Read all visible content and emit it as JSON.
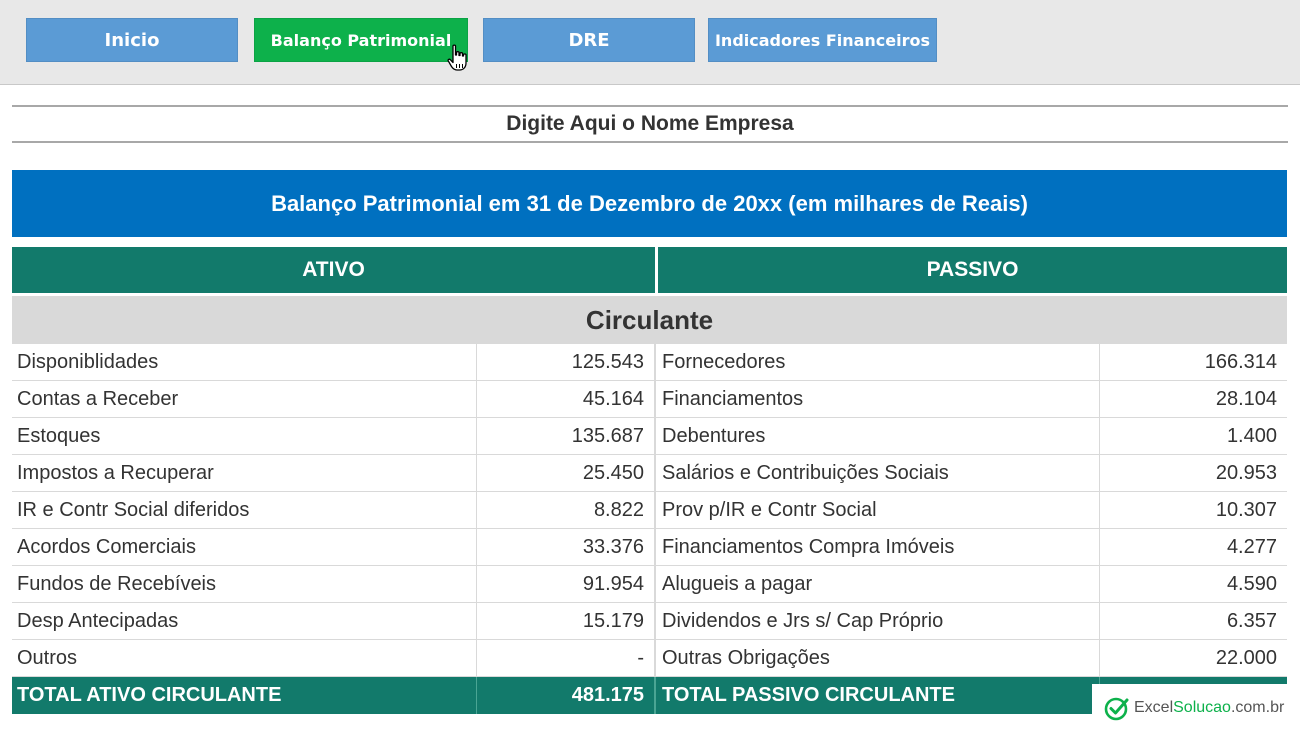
{
  "nav": {
    "inicio": "Inicio",
    "balanco": "Balanço Patrimonial",
    "dre": "DRE",
    "indicadores": "Indicadores Financeiros"
  },
  "company_name": "Digite Aqui o Nome Empresa",
  "title": "Balanço Patrimonial em 31 de Dezembro de 20xx (em milhares de Reais)",
  "headers": {
    "ativo": "ATIVO",
    "passivo": "PASSIVO"
  },
  "section": "Circulante",
  "rows": [
    {
      "a_label": "Disponiblidades",
      "a_value": "125.543",
      "p_label": "Fornecedores",
      "p_value": "166.314"
    },
    {
      "a_label": "Contas a Receber",
      "a_value": "45.164",
      "p_label": "Financiamentos",
      "p_value": "28.104"
    },
    {
      "a_label": "Estoques",
      "a_value": "135.687",
      "p_label": "Debentures",
      "p_value": "1.400"
    },
    {
      "a_label": "Impostos a Recuperar",
      "a_value": "25.450",
      "p_label": "Salários e Contribuições Sociais",
      "p_value": "20.953"
    },
    {
      "a_label": "IR e Contr Social diferidos",
      "a_value": "8.822",
      "p_label": "Prov p/IR e Contr Social",
      "p_value": "10.307"
    },
    {
      "a_label": "Acordos Comerciais",
      "a_value": "33.376",
      "p_label": "Financiamentos Compra Imóveis",
      "p_value": "4.277"
    },
    {
      "a_label": "Fundos de Recebíveis",
      "a_value": "91.954",
      "p_label": "Alugueis a pagar",
      "p_value": "4.590"
    },
    {
      "a_label": "Desp Antecipadas",
      "a_value": "15.179",
      "p_label": "Dividendos e Jrs s/ Cap Próprio",
      "p_value": "6.357"
    },
    {
      "a_label": "Outros",
      "a_value": "-",
      "p_label": "Outras Obrigações",
      "p_value": "22.000"
    }
  ],
  "totals": {
    "a_label": "TOTAL ATIVO CIRCULANTE",
    "a_value": "481.175",
    "p_label": "TOTAL PASSIVO CIRCULANTE"
  },
  "logo": {
    "part1": "Excel",
    "part2": "Solucao",
    "part3": ".com.br"
  },
  "colors": {
    "nav_blue": "#5b9bd5",
    "nav_active": "#0db14b",
    "title_blue": "#0070c0",
    "teal": "#127a6b",
    "section_grey": "#d9d9d9"
  },
  "icons": {
    "cursor": "hand-pointer-icon",
    "logo": "check-circle-icon"
  }
}
